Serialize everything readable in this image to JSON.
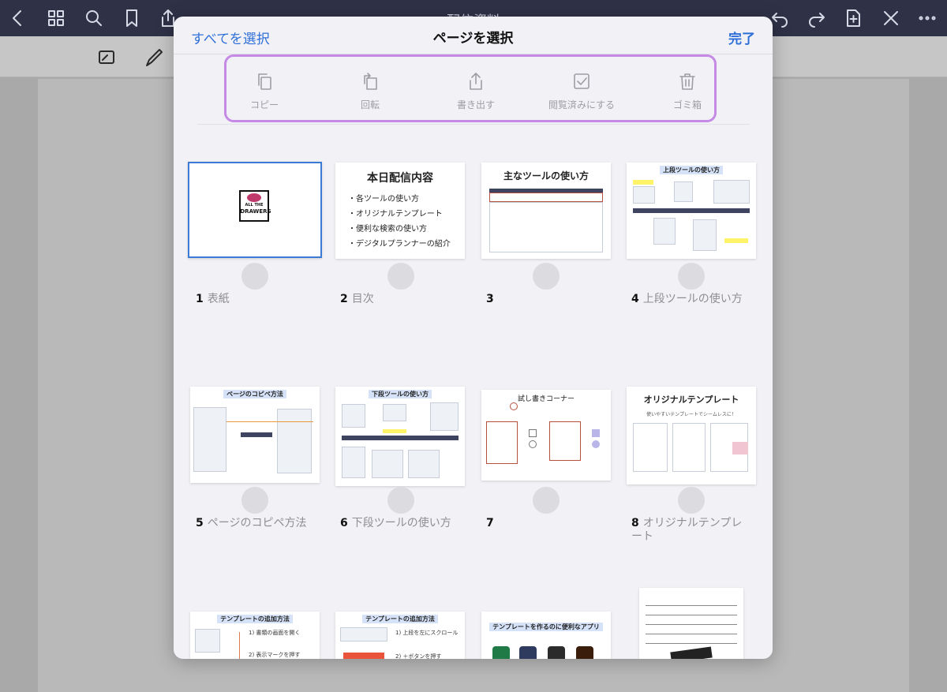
{
  "app": {
    "document_title": "配信資料"
  },
  "modal": {
    "select_all_label": "すべてを選択",
    "title": "ページを選択",
    "done_label": "完了",
    "actions": [
      {
        "label": "コピー",
        "icon": "copy-icon"
      },
      {
        "label": "回転",
        "icon": "rotate-icon"
      },
      {
        "label": "書き出す",
        "icon": "export-icon"
      },
      {
        "label": "閲覧済みにする",
        "icon": "checkbox-icon"
      },
      {
        "label": "ゴミ箱",
        "icon": "trash-icon"
      }
    ]
  },
  "pages": [
    {
      "number": "1",
      "title": "表紙",
      "thumb_text": [
        "ALL THE",
        "DRAWERS"
      ],
      "selected": true
    },
    {
      "number": "2",
      "title": "目次",
      "thumb_heading": "本日配信内容",
      "thumb_bullets": [
        "・各ツールの使い方",
        "・オリジナルテンプレート",
        "・便利な検索の使い方",
        "・デジタルプランナーの紹介"
      ]
    },
    {
      "number": "3",
      "title": "",
      "thumb_heading": "主なツールの使い方"
    },
    {
      "number": "4",
      "title": "上段ツールの使い方",
      "thumb_heading": "上段ツールの使い方"
    },
    {
      "number": "5",
      "title": "ページのコピペ方法",
      "thumb_heading": "ページのコピペ方法"
    },
    {
      "number": "6",
      "title": "下段ツールの使い方",
      "thumb_heading": "下段ツールの使い方"
    },
    {
      "number": "7",
      "title": "",
      "thumb_heading": "試し書きコーナー"
    },
    {
      "number": "8",
      "title": "オリジナルテンプレート",
      "thumb_heading": "オリジナルテンプレート",
      "thumb_sub": "使いやすいテンプレートでシームレスに！"
    },
    {
      "thumb_heading": "テンプレートの追加方法",
      "thumb_lines": [
        "1) 書類の画面を開く",
        "2) 表示マークを押す"
      ]
    },
    {
      "thumb_heading": "テンプレートの追加方法",
      "thumb_lines": [
        "1) 上段を左にスクロール",
        "2) ＋ボタンを押す"
      ]
    },
    {
      "thumb_heading": "テンプレートを作るのに便利なアプリ"
    },
    {
      "thumb_heading": ""
    }
  ],
  "colors": {
    "accent": "#2f6fd8",
    "highlight_border": "#c48ae6",
    "selected_border": "#3b7bd6",
    "topbar": "#2f3247"
  }
}
